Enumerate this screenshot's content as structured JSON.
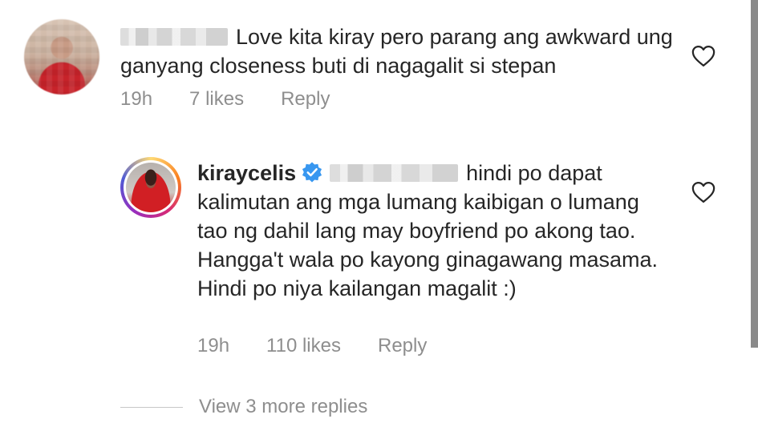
{
  "main_comment": {
    "text": "Love kita kiray pero parang ang awkward ung ganyang closeness buti di nagagalit si stepan",
    "time": "19h",
    "likes": "7 likes",
    "reply_label": "Reply"
  },
  "reply_comment": {
    "username": "kiraycelis",
    "text": "hindi po dapat kalimutan ang mga lumang kaibigan o lumang tao ng dahil lang may boyfriend po akong tao. Hangga't wala po kayong ginagawang masama. Hindi po niya kailangan magalit :)",
    "time": "19h",
    "likes": "110 likes",
    "reply_label": "Reply"
  },
  "view_more": {
    "label": "View 3 more replies"
  },
  "colors": {
    "text": "#262626",
    "meta": "#8e8e8e",
    "verified": "#3897f0"
  },
  "icons": {
    "like": "heart-outline-icon",
    "verified": "verified-badge-icon"
  }
}
